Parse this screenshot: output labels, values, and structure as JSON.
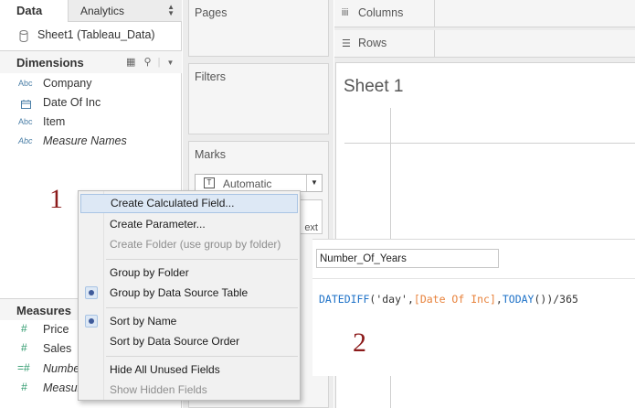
{
  "data_pane": {
    "tab_data": "Data",
    "tab_analytics": "Analytics",
    "datasource": "Sheet1 (Tableau_Data)",
    "dimensions_header": "Dimensions",
    "dimensions": [
      {
        "type": "Abc",
        "name": "Company"
      },
      {
        "type": "date",
        "name": "Date Of Inc"
      },
      {
        "type": "Abc",
        "name": "Item"
      },
      {
        "type": "Abc",
        "name": "Measure Names"
      }
    ],
    "measures_header": "Measures",
    "measures": [
      {
        "type": "#",
        "name": "Price"
      },
      {
        "type": "#",
        "name": "Sales"
      },
      {
        "type": "=#",
        "name": "Number"
      },
      {
        "type": "#",
        "name": "Measur"
      }
    ]
  },
  "shelves": {
    "pages": "Pages",
    "filters": "Filters",
    "marks": "Marks",
    "marks_type": "Automatic",
    "marks_text_btn": "ext",
    "columns": "Columns",
    "rows": "Rows"
  },
  "sheet": {
    "title": "Sheet 1"
  },
  "calc_editor": {
    "name_value": "Number_Of_Years",
    "formula": {
      "fn1": "DATEDIFF",
      "open1": "(",
      "str": "'day'",
      "comma1": ",",
      "field": "[Date Of Inc]",
      "comma2": ",",
      "fn2": "TODAY",
      "rest": "())/365"
    }
  },
  "context_menu": {
    "items": [
      {
        "label": "Create Calculated Field...",
        "state": "highlighted"
      },
      {
        "label": "Create Parameter...",
        "state": "enabled"
      },
      {
        "label": "Create Folder (use group by folder)",
        "state": "disabled"
      },
      {
        "label": "Group by Folder",
        "state": "enabled"
      },
      {
        "label": "Group by Data Source Table",
        "state": "checked"
      },
      {
        "label": "Sort by Name",
        "state": "checked"
      },
      {
        "label": "Sort by Data Source Order",
        "state": "enabled"
      },
      {
        "label": "Hide All Unused Fields",
        "state": "enabled"
      },
      {
        "label": "Show Hidden Fields",
        "state": "disabled"
      }
    ]
  },
  "annotations": {
    "one": "1",
    "two": "2"
  },
  "colors": {
    "annotation": "#8b1a1a",
    "formula_function": "#1e72c8",
    "formula_field": "#e8823b",
    "menu_highlight": "#dde8f5"
  }
}
